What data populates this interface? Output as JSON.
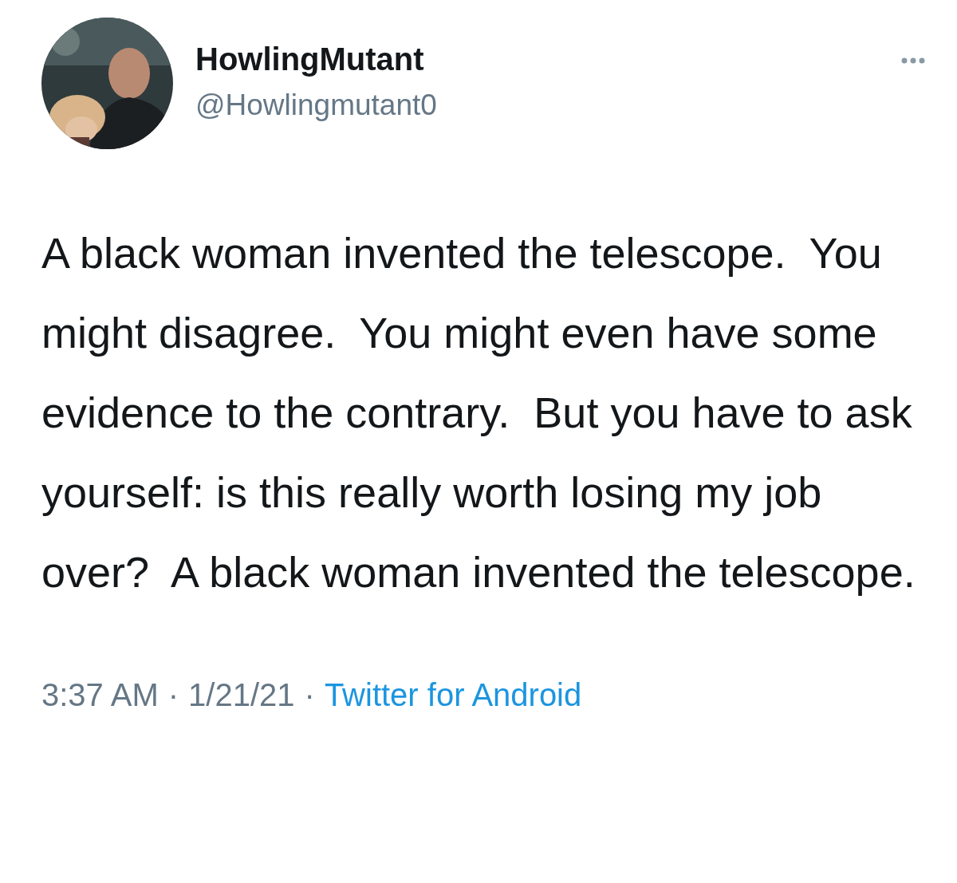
{
  "author": {
    "name": "HowlingMutant",
    "handle": "@Howlingmutant0"
  },
  "tweet": {
    "text": "A black woman invented the telescope.  You might disagree.  You might even have some evidence to the contrary.  But you have to ask yourself: is this really worth losing my job over?  A black woman invented the telescope."
  },
  "meta": {
    "time": "3:37 AM",
    "separators": [
      "·",
      "·"
    ],
    "date": "1/21/21",
    "source": "Twitter for Android"
  }
}
